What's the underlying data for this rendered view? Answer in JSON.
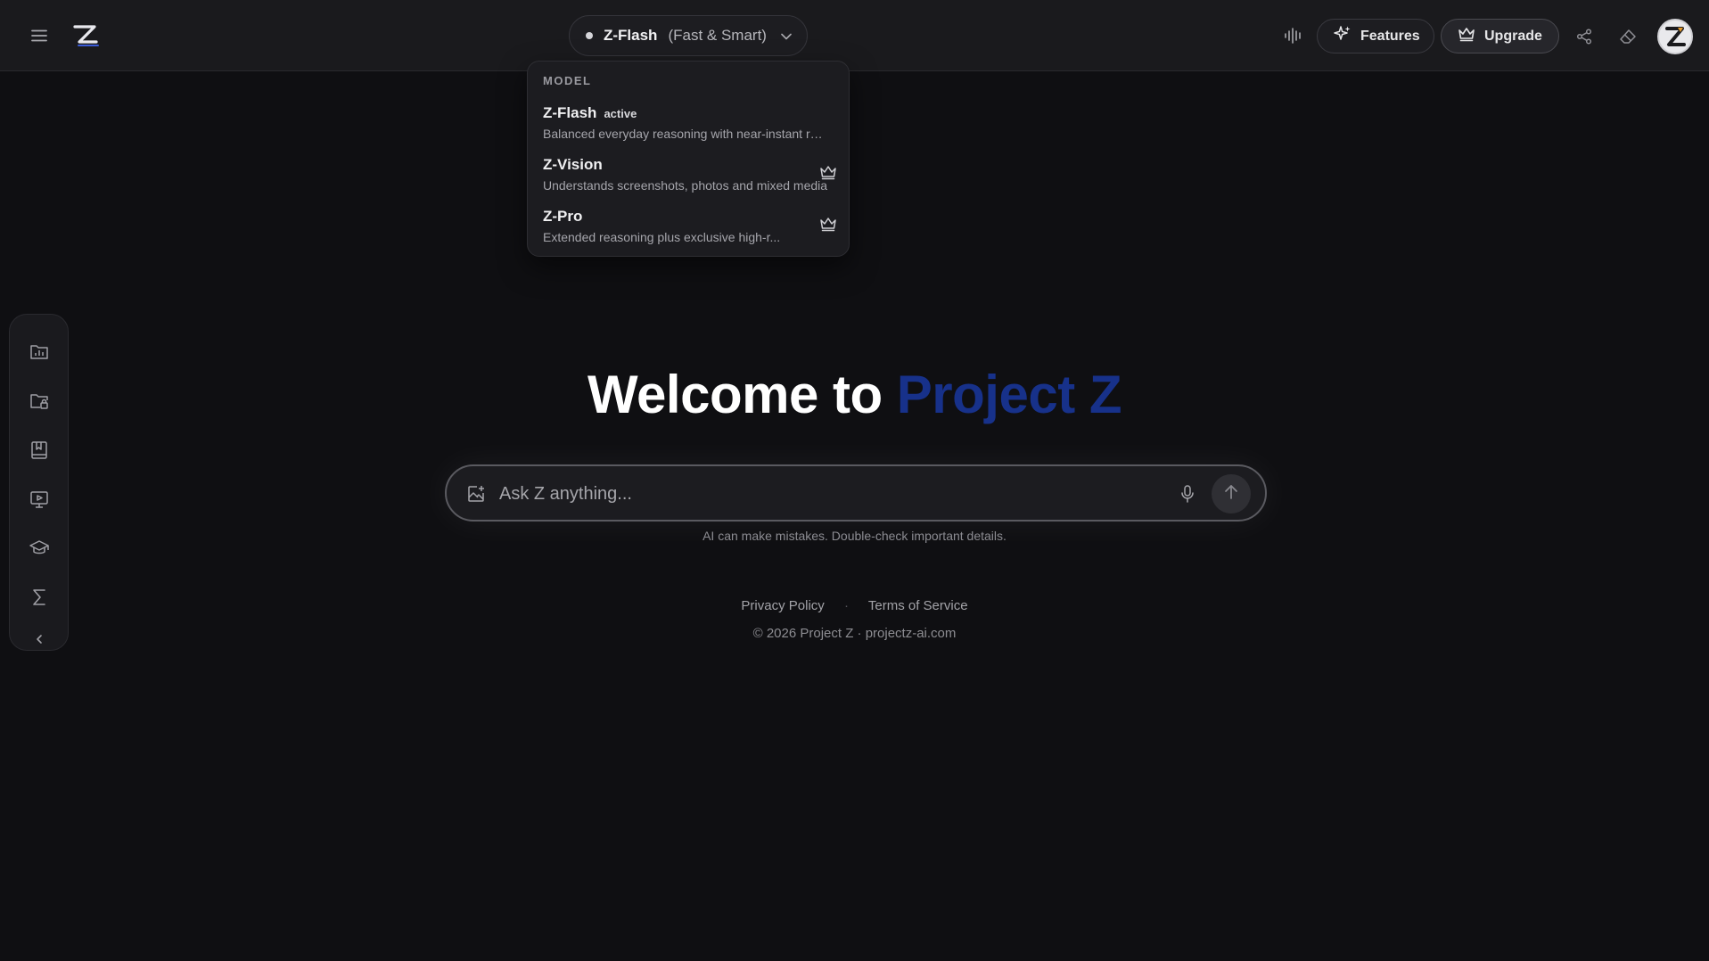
{
  "header": {
    "model_selector": {
      "name": "Z-Flash",
      "subtitle": "(Fast & Smart)"
    },
    "features_label": "Features",
    "upgrade_label": "Upgrade"
  },
  "dropdown": {
    "header": "MODEL",
    "items": [
      {
        "title": "Z-Flash",
        "badge": "active",
        "description": "Balanced everyday reasoning with near-instant responses",
        "icon": "none"
      },
      {
        "title": "Z-Vision",
        "badge": "",
        "description": "Understands screenshots, photos and mixed media",
        "icon": "crown-icon"
      },
      {
        "title": "Z-Pro",
        "badge": "",
        "description": "Extended reasoning plus exclusive high-r...",
        "icon": "crown-icon"
      }
    ]
  },
  "main": {
    "welcome_prefix": "Welcome to",
    "welcome_brand": "Project Z",
    "search_placeholder": "Ask Z anything...",
    "disclaimer": "AI can make mistakes. Double-check important details."
  },
  "footer": {
    "privacy": "Privacy Policy",
    "separator": "·",
    "terms": "Terms of Service",
    "copyright": "© 2026 Project Z · projectz-ai.com"
  },
  "colors": {
    "background": "#0f0f12",
    "accent": "#17318a"
  }
}
